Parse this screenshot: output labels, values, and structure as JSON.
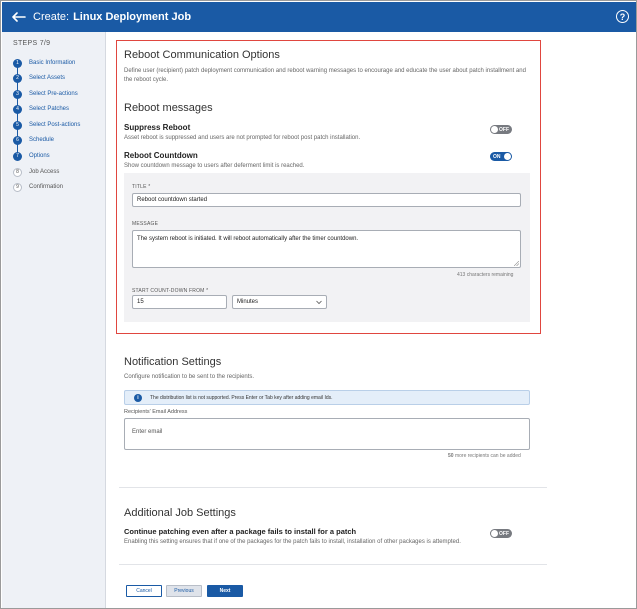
{
  "header": {
    "title_prefix": "Create:",
    "title_main": "Linux Deployment Job",
    "help_glyph": "?"
  },
  "sidebar": {
    "steps_title": "STEPS 7/9",
    "steps": [
      {
        "num": "1",
        "label": "Basic Information",
        "state": "done"
      },
      {
        "num": "2",
        "label": "Select Assets",
        "state": "done"
      },
      {
        "num": "3",
        "label": "Select Pre-actions",
        "state": "done"
      },
      {
        "num": "4",
        "label": "Select Patches",
        "state": "done"
      },
      {
        "num": "5",
        "label": "Select Post-actions",
        "state": "done"
      },
      {
        "num": "6",
        "label": "Schedule",
        "state": "done"
      },
      {
        "num": "7",
        "label": "Options",
        "state": "current"
      },
      {
        "num": "8",
        "label": "Job Access",
        "state": "pending"
      },
      {
        "num": "9",
        "label": "Confirmation",
        "state": "pending"
      }
    ]
  },
  "reboot_comm": {
    "title": "Reboot Communication Options",
    "description": "Define user (recipient) patch deployment communication and reboot warning messages to encourage and educate the user about patch installment and the reboot cycle."
  },
  "reboot_messages": {
    "title": "Reboot messages",
    "suppress": {
      "label": "Suppress Reboot",
      "description": "Asset reboot is suppressed and users are not prompted for reboot post patch installation.",
      "toggle_text": "OFF"
    },
    "countdown": {
      "label": "Reboot Countdown",
      "description": "Show countdown message to users after deferment limit is reached.",
      "toggle_text": "ON"
    },
    "form": {
      "title_label": "TITLE *",
      "title_value": "Reboot countdown started",
      "message_label": "MESSAGE",
      "message_value": "The system reboot is initiated. It will reboot automatically after the timer countdown.",
      "chars_remaining": "413 characters remaining",
      "countdown_label": "START COUNT-DOWN FROM *",
      "countdown_value": "15",
      "unit_value": "Minutes"
    }
  },
  "notification": {
    "title": "Notification Settings",
    "description": "Configure notification to be sent to the recipients.",
    "info_glyph": "i",
    "info_text": "The distribution list is not supported. Press Enter or Tab key after adding email Ids.",
    "recipients_label": "Recipients' Email Address",
    "email_placeholder": "Enter email",
    "recipients_count": "50",
    "recipients_suffix": "more recipients can be added"
  },
  "additional": {
    "title": "Additional Job Settings",
    "continue_label": "Continue patching even after a package fails to install for a patch",
    "continue_description": "Enabling this setting ensures that if one of the packages for the patch fails to install, installation of other packages is attempted.",
    "toggle_text": "OFF"
  },
  "footer": {
    "cancel": "Cancel",
    "previous": "Previous",
    "next": "Next"
  },
  "colors": {
    "brand": "#1a5aa5",
    "highlight": "#e0463f"
  }
}
